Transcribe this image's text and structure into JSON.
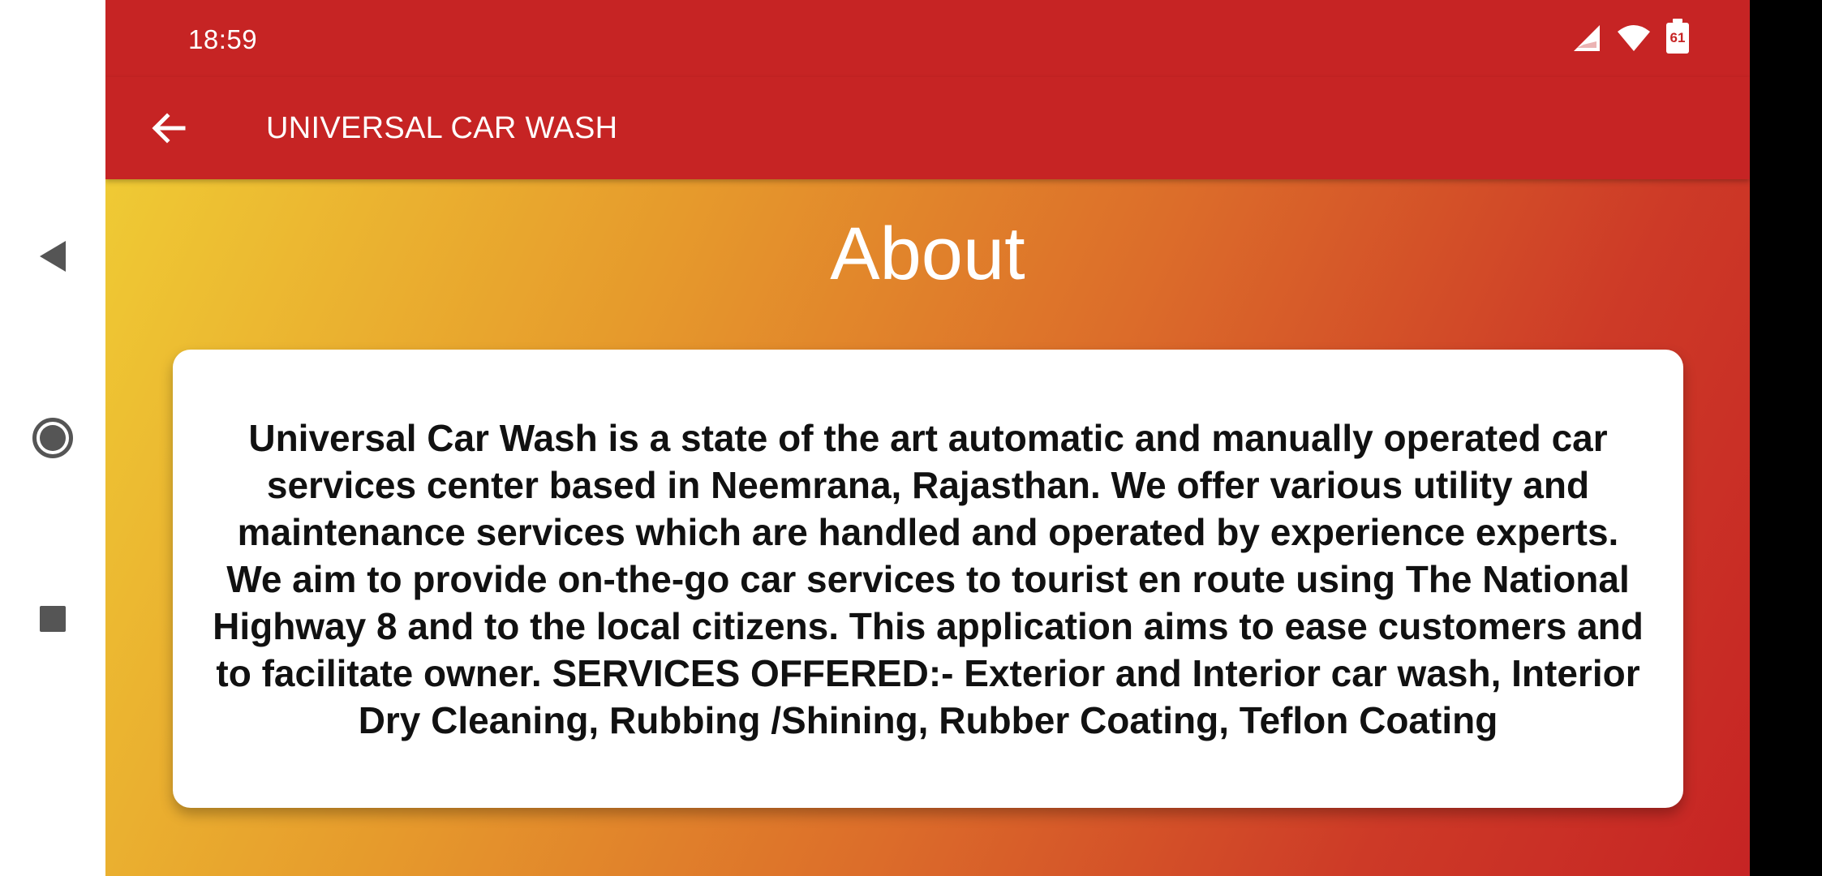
{
  "status_bar": {
    "time": "18:59",
    "battery_level": "61"
  },
  "toolbar": {
    "title": "UNIVERSAL CAR WASH"
  },
  "main": {
    "heading": "About",
    "description": "Universal Car Wash is a state of the art automatic and manually operated car services center based in  Neemrana, Rajasthan. We offer various utility and maintenance services which are handled and operated by experience experts. We aim to provide on-the-go car services to tourist en route using The National Highway 8 and to the local citizens. This application aims to ease customers and to facilitate owner. SERVICES OFFERED:- Exterior and Interior car wash, Interior Dry Cleaning, Rubbing /Shining, Rubber Coating, Teflon Coating"
  },
  "colors": {
    "primary": "#c62424",
    "gradient_start": "#efca34",
    "gradient_end": "#c62424"
  },
  "icons": {
    "nav_back": "triangle-back-icon",
    "nav_home": "home-circle-icon",
    "nav_recents": "square-recents-icon",
    "toolbar_back": "arrow-left-icon",
    "signal": "signal-icon",
    "wifi": "wifi-icon",
    "battery": "battery-icon"
  }
}
